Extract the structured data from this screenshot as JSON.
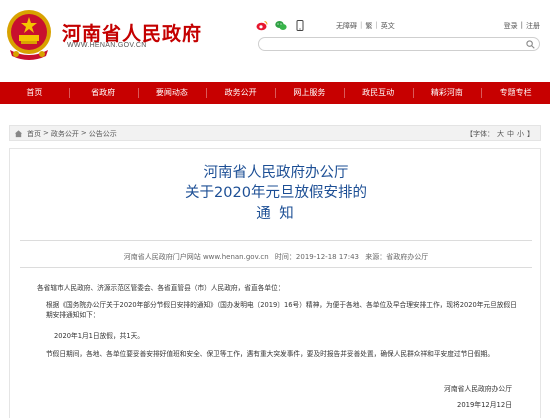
{
  "header": {
    "site_title": "河南省人民政府",
    "site_domain": "WWW.HENAN.GOV.CN",
    "top_links": [
      "无障碍",
      "繁",
      "英文"
    ],
    "login_links": [
      "登录",
      "注册"
    ],
    "social_icons": [
      "weibo-icon",
      "wechat-icon",
      "app-icon"
    ]
  },
  "nav": {
    "items": [
      "首页",
      "省政府",
      "要闻动态",
      "政务公开",
      "网上服务",
      "政民互动",
      "精彩河南",
      "专题专栏"
    ]
  },
  "breadcrumb": {
    "items": [
      "首页",
      "政务公开",
      "公告公示"
    ],
    "separator": ">",
    "font_size_label": "【字体：",
    "font_sizes": [
      "大",
      "中",
      "小"
    ],
    "font_size_end": "】"
  },
  "article": {
    "title_line1": "河南省人民政府办公厅",
    "title_line2": "关于2020年元旦放假安排的",
    "title_line3": "通    知",
    "source": "河南省人民政府门户网站 www.henan.gov.cn",
    "time": "时间：2019-12-18 17:43",
    "origin": "来源：省政府办公厅",
    "salutation": "各省辖市人民政府、济源示范区管委会、各省直管县（市）人民政府，省直各单位：",
    "para1": "根据《国务院办公厅关于2020年部分节假日安排的通知》（国办发明电〔2019〕16号）精神，为便于各地、各单位及早合理安排工作，现将2020年元旦放假日期安排通知如下：",
    "para2": "2020年1月1日放假，共1天。",
    "para3": "节假日期间，各地、各单位要妥善安排好值班和安全、保卫等工作，遇有重大突发事件，要及时报告并妥善处置，确保人民群众祥和平安度过节日假期。",
    "signature": "河南省人民政府办公厅",
    "date": "2019年12月12日"
  },
  "colors": {
    "brand_red": "#c70000",
    "title_blue": "#1d4f95"
  }
}
